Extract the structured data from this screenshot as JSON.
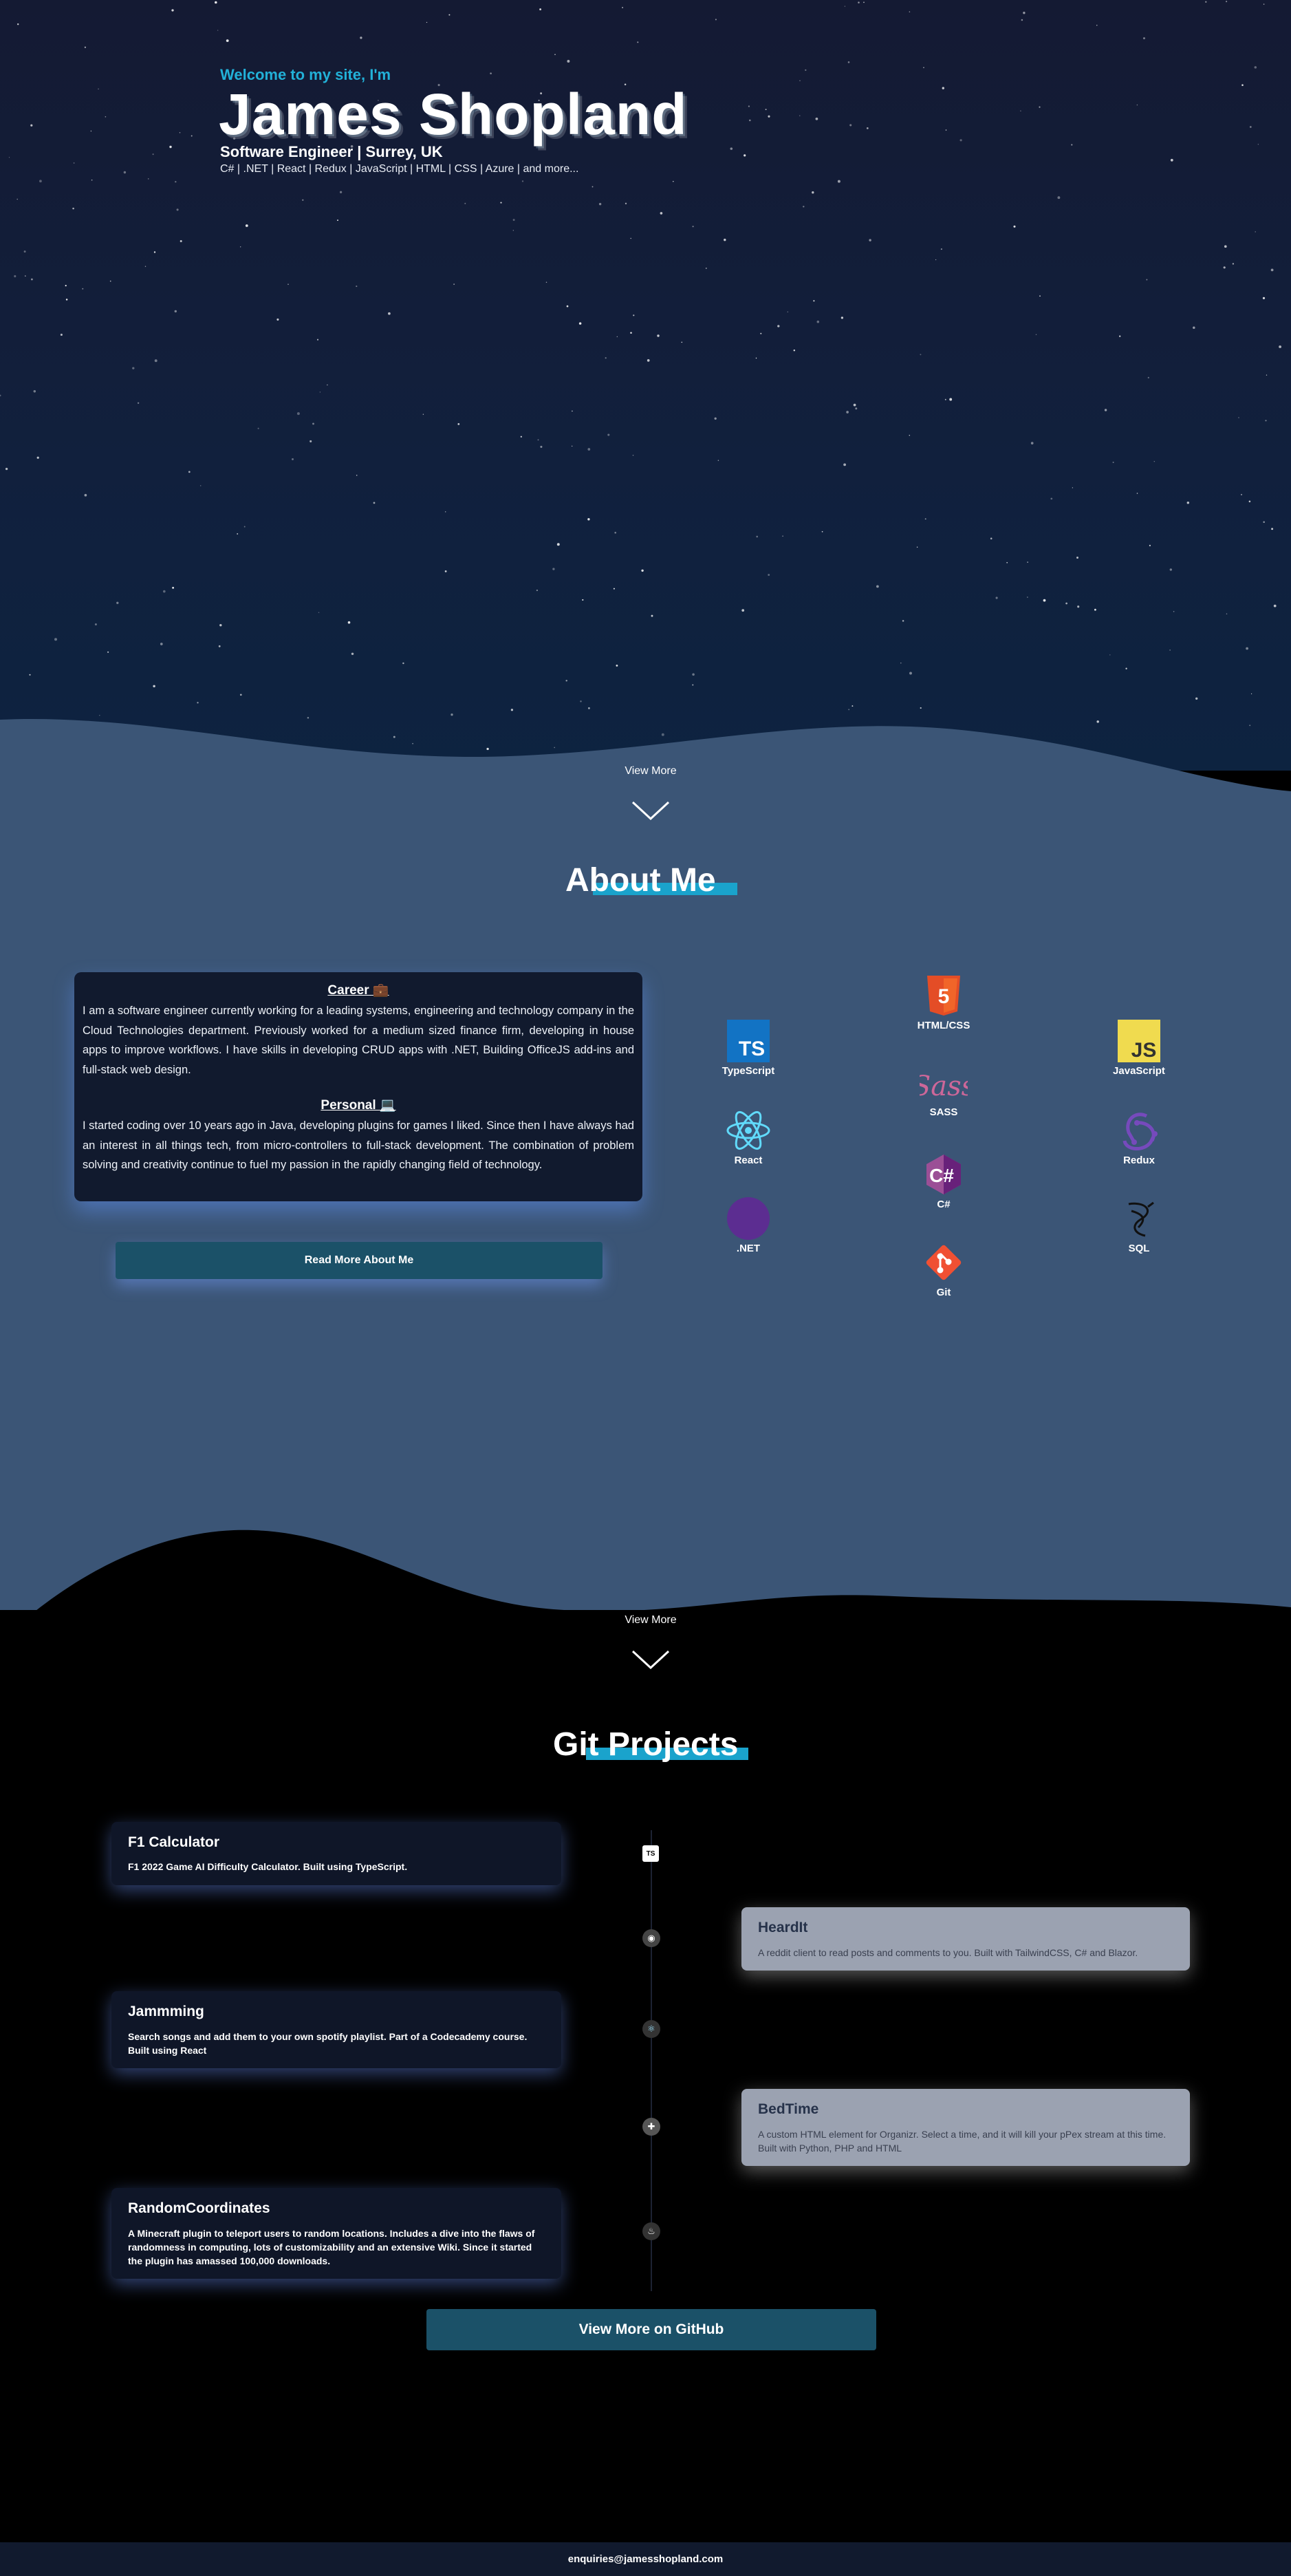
{
  "hero": {
    "welcome": "Welcome to my site, I'm",
    "name": "James Shopland",
    "role": "Software Engineer | Surrey, UK",
    "skills": "C# | .NET | React | Redux | JavaScript | HTML | CSS | Azure | and more..."
  },
  "view_more_label": "View More",
  "about": {
    "title": "About Me",
    "career_heading": "Career 💼",
    "career_text": "I am a software engineer currently working for a leading systems, engineering and technology company in the Cloud Technologies department. Previously worked for a medium sized finance firm, developing in house apps to improve workflows. I have skills in developing CRUD apps with .NET, Building OfficeJS add-ins and full-stack web design.",
    "personal_heading": "Personal 💻",
    "personal_text": "I started coding over 10 years ago in Java, developing plugins for games I liked. Since then I have always had an interest in all things tech, from micro-controllers to full-stack development. The combination of problem solving and creativity continue to fuel my passion in the rapidly changing field of technology.",
    "read_more": "Read More About Me",
    "tech": [
      {
        "label": "HTML/CSS",
        "icon": "html5-icon"
      },
      {
        "label": "TypeScript",
        "icon": "typescript-icon"
      },
      {
        "label": "JavaScript",
        "icon": "javascript-icon"
      },
      {
        "label": "SASS",
        "icon": "sass-icon"
      },
      {
        "label": "React",
        "icon": "react-icon"
      },
      {
        "label": "Redux",
        "icon": "redux-icon"
      },
      {
        "label": "C#",
        "icon": "csharp-icon"
      },
      {
        "label": ".NET",
        "icon": "dotnet-icon"
      },
      {
        "label": "SQL",
        "icon": "sql-icon"
      },
      {
        "label": "Git",
        "icon": "git-icon"
      }
    ]
  },
  "projects": {
    "title": "Git Projects",
    "items": [
      {
        "title": "F1 Calculator",
        "desc": "F1 2022 Game AI Difficulty Calculator. Built using TypeScript.",
        "icon": "typescript-icon"
      },
      {
        "title": "HeardIt",
        "desc": "A reddit client to read posts and comments to you. Built with TailwindCSS, C# and Blazor.",
        "icon": "blazor-icon"
      },
      {
        "title": "Jammming",
        "desc": "Search songs and add them to your own spotify playlist. Part of a Codecademy course. Built using React",
        "icon": "react-icon"
      },
      {
        "title": "BedTime",
        "desc": "A custom HTML element for Organizr. Select a time, and it will kill your pPex stream at this time. Built with Python, PHP and HTML",
        "icon": "python-icon"
      },
      {
        "title": "RandomCoordinates",
        "desc": "A Minecraft plugin to teleport users to random locations. Includes a dive into the flaws of randomness in computing, lots of customizability and an extensive Wiki. Since it started the plugin has amassed 100,000 downloads.",
        "icon": "java-icon"
      }
    ],
    "github_button": "View More on GitHub"
  },
  "footer": {
    "email": "enquiries@jamesshopland.com"
  },
  "colors": {
    "accent": "#1aa3cc",
    "about_bg": "#3b5576",
    "card_bg": "#111a2e",
    "button_bg": "#1b5168"
  }
}
